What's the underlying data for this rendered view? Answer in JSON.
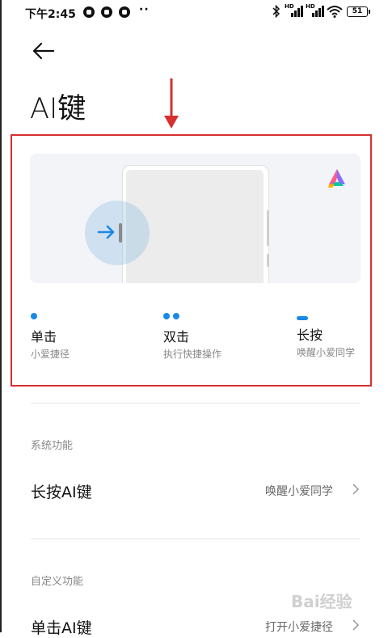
{
  "status_bar": {
    "time": "下午2:45",
    "more": "··",
    "battery": "51",
    "signal1_label": "HD",
    "signal2_label": "HD"
  },
  "header": {
    "title": "AI键"
  },
  "actions": [
    {
      "title": "单击",
      "subtitle": "小爱捷径"
    },
    {
      "title": "双击",
      "subtitle": "执行快捷操作"
    },
    {
      "title": "长按",
      "subtitle": "唤醒小爱同学"
    }
  ],
  "sections": [
    {
      "label": "系统功能",
      "row": {
        "label": "长按AI键",
        "value": "唤醒小爱同学"
      }
    },
    {
      "label": "自定义功能",
      "row": {
        "label": "单击AI键",
        "value": "打开小爱捷径"
      }
    }
  ],
  "colors": {
    "accent": "#1a88e5",
    "highlight": "#d63031"
  },
  "watermark": "Bai经验"
}
